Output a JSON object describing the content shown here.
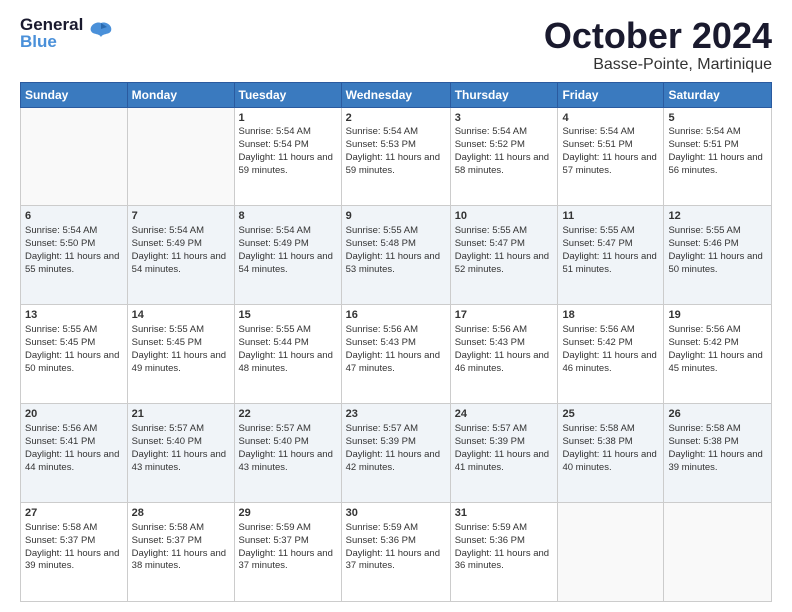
{
  "logo": {
    "line1": "General",
    "line2": "Blue",
    "tagline": "▶"
  },
  "header": {
    "month": "October 2024",
    "location": "Basse-Pointe, Martinique"
  },
  "days_of_week": [
    "Sunday",
    "Monday",
    "Tuesday",
    "Wednesday",
    "Thursday",
    "Friday",
    "Saturday"
  ],
  "weeks": [
    [
      {
        "day": "",
        "content": ""
      },
      {
        "day": "",
        "content": ""
      },
      {
        "day": "1",
        "content": "Sunrise: 5:54 AM\nSunset: 5:54 PM\nDaylight: 11 hours and 59 minutes."
      },
      {
        "day": "2",
        "content": "Sunrise: 5:54 AM\nSunset: 5:53 PM\nDaylight: 11 hours and 59 minutes."
      },
      {
        "day": "3",
        "content": "Sunrise: 5:54 AM\nSunset: 5:52 PM\nDaylight: 11 hours and 58 minutes."
      },
      {
        "day": "4",
        "content": "Sunrise: 5:54 AM\nSunset: 5:51 PM\nDaylight: 11 hours and 57 minutes."
      },
      {
        "day": "5",
        "content": "Sunrise: 5:54 AM\nSunset: 5:51 PM\nDaylight: 11 hours and 56 minutes."
      }
    ],
    [
      {
        "day": "6",
        "content": "Sunrise: 5:54 AM\nSunset: 5:50 PM\nDaylight: 11 hours and 55 minutes."
      },
      {
        "day": "7",
        "content": "Sunrise: 5:54 AM\nSunset: 5:49 PM\nDaylight: 11 hours and 54 minutes."
      },
      {
        "day": "8",
        "content": "Sunrise: 5:54 AM\nSunset: 5:49 PM\nDaylight: 11 hours and 54 minutes."
      },
      {
        "day": "9",
        "content": "Sunrise: 5:55 AM\nSunset: 5:48 PM\nDaylight: 11 hours and 53 minutes."
      },
      {
        "day": "10",
        "content": "Sunrise: 5:55 AM\nSunset: 5:47 PM\nDaylight: 11 hours and 52 minutes."
      },
      {
        "day": "11",
        "content": "Sunrise: 5:55 AM\nSunset: 5:47 PM\nDaylight: 11 hours and 51 minutes."
      },
      {
        "day": "12",
        "content": "Sunrise: 5:55 AM\nSunset: 5:46 PM\nDaylight: 11 hours and 50 minutes."
      }
    ],
    [
      {
        "day": "13",
        "content": "Sunrise: 5:55 AM\nSunset: 5:45 PM\nDaylight: 11 hours and 50 minutes."
      },
      {
        "day": "14",
        "content": "Sunrise: 5:55 AM\nSunset: 5:45 PM\nDaylight: 11 hours and 49 minutes."
      },
      {
        "day": "15",
        "content": "Sunrise: 5:55 AM\nSunset: 5:44 PM\nDaylight: 11 hours and 48 minutes."
      },
      {
        "day": "16",
        "content": "Sunrise: 5:56 AM\nSunset: 5:43 PM\nDaylight: 11 hours and 47 minutes."
      },
      {
        "day": "17",
        "content": "Sunrise: 5:56 AM\nSunset: 5:43 PM\nDaylight: 11 hours and 46 minutes."
      },
      {
        "day": "18",
        "content": "Sunrise: 5:56 AM\nSunset: 5:42 PM\nDaylight: 11 hours and 46 minutes."
      },
      {
        "day": "19",
        "content": "Sunrise: 5:56 AM\nSunset: 5:42 PM\nDaylight: 11 hours and 45 minutes."
      }
    ],
    [
      {
        "day": "20",
        "content": "Sunrise: 5:56 AM\nSunset: 5:41 PM\nDaylight: 11 hours and 44 minutes."
      },
      {
        "day": "21",
        "content": "Sunrise: 5:57 AM\nSunset: 5:40 PM\nDaylight: 11 hours and 43 minutes."
      },
      {
        "day": "22",
        "content": "Sunrise: 5:57 AM\nSunset: 5:40 PM\nDaylight: 11 hours and 43 minutes."
      },
      {
        "day": "23",
        "content": "Sunrise: 5:57 AM\nSunset: 5:39 PM\nDaylight: 11 hours and 42 minutes."
      },
      {
        "day": "24",
        "content": "Sunrise: 5:57 AM\nSunset: 5:39 PM\nDaylight: 11 hours and 41 minutes."
      },
      {
        "day": "25",
        "content": "Sunrise: 5:58 AM\nSunset: 5:38 PM\nDaylight: 11 hours and 40 minutes."
      },
      {
        "day": "26",
        "content": "Sunrise: 5:58 AM\nSunset: 5:38 PM\nDaylight: 11 hours and 39 minutes."
      }
    ],
    [
      {
        "day": "27",
        "content": "Sunrise: 5:58 AM\nSunset: 5:37 PM\nDaylight: 11 hours and 39 minutes."
      },
      {
        "day": "28",
        "content": "Sunrise: 5:58 AM\nSunset: 5:37 PM\nDaylight: 11 hours and 38 minutes."
      },
      {
        "day": "29",
        "content": "Sunrise: 5:59 AM\nSunset: 5:37 PM\nDaylight: 11 hours and 37 minutes."
      },
      {
        "day": "30",
        "content": "Sunrise: 5:59 AM\nSunset: 5:36 PM\nDaylight: 11 hours and 37 minutes."
      },
      {
        "day": "31",
        "content": "Sunrise: 5:59 AM\nSunset: 5:36 PM\nDaylight: 11 hours and 36 minutes."
      },
      {
        "day": "",
        "content": ""
      },
      {
        "day": "",
        "content": ""
      }
    ]
  ]
}
